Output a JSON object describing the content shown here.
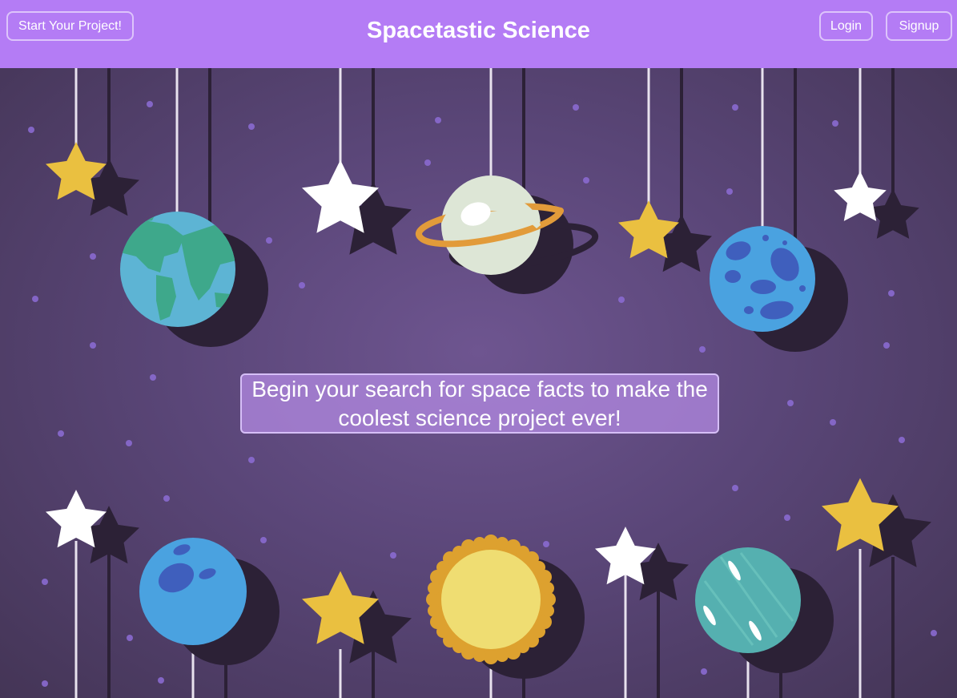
{
  "header": {
    "start_label": "Start Your Project!",
    "title": "Spacetastic Science",
    "login_label": "Login",
    "signup_label": "Signup"
  },
  "hero": {
    "message": "Begin your search for space facts to make the coolest science project ever!"
  },
  "colors": {
    "header_bg": "#b47cf5",
    "star_yellow": "#eac040",
    "star_white": "#ffffff",
    "shadow": "#2c2136",
    "earth_ocean": "#5db4d4",
    "earth_land": "#3ea88b",
    "planet_blue": "#4aa2e0",
    "crater_blue": "#3f5fbd",
    "sun_core": "#efdd72",
    "sun_rays": "#dda12f",
    "saturn_body": "#dde6d6",
    "saturn_ring": "#e29b3a",
    "teal_planet": "#55b0b0"
  },
  "icons": [
    "star-icon",
    "earth-icon",
    "saturn-icon",
    "blue-planet-icon",
    "sun-icon",
    "teal-planet-icon"
  ]
}
